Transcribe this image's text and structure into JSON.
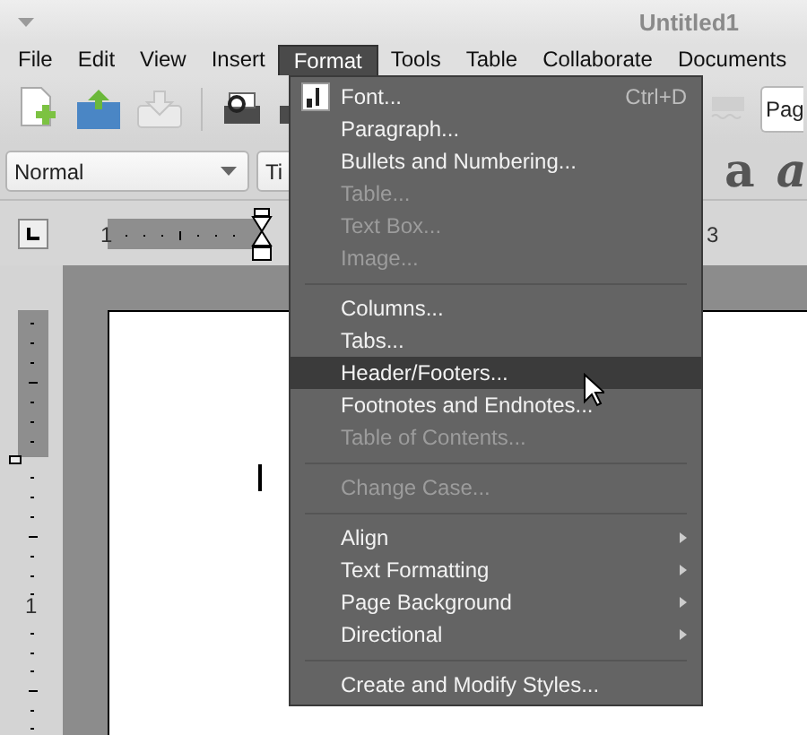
{
  "window": {
    "title": "Untitled1"
  },
  "menu_bar": [
    {
      "label": "File",
      "selected": false
    },
    {
      "label": "Edit",
      "selected": false
    },
    {
      "label": "View",
      "selected": false
    },
    {
      "label": "Insert",
      "selected": false
    },
    {
      "label": "Format",
      "selected": true
    },
    {
      "label": "Tools",
      "selected": false
    },
    {
      "label": "Table",
      "selected": false
    },
    {
      "label": "Collaborate",
      "selected": false
    },
    {
      "label": "Documents",
      "selected": false
    }
  ],
  "toolbar": {
    "page_dropdown": "Pag"
  },
  "format_bar": {
    "style": "Normal",
    "font": "Ti",
    "style_glyphs": [
      "a",
      "a"
    ]
  },
  "horizontal_ruler": {
    "labels": [
      "1",
      "3"
    ]
  },
  "vertical_ruler": {
    "labels": [
      "1"
    ]
  },
  "format_menu": [
    {
      "kind": "item",
      "label": "Font...",
      "shortcut": "Ctrl+D",
      "icon": true,
      "disabled": false,
      "selected": false
    },
    {
      "kind": "item",
      "label": "Paragraph...",
      "disabled": false,
      "selected": false
    },
    {
      "kind": "item",
      "label": "Bullets and Numbering...",
      "disabled": false,
      "selected": false
    },
    {
      "kind": "item",
      "label": "Table...",
      "disabled": true,
      "selected": false
    },
    {
      "kind": "item",
      "label": "Text Box...",
      "disabled": true,
      "selected": false
    },
    {
      "kind": "item",
      "label": "Image...",
      "disabled": true,
      "selected": false
    },
    {
      "kind": "separator"
    },
    {
      "kind": "item",
      "label": "Columns...",
      "disabled": false,
      "selected": false
    },
    {
      "kind": "item",
      "label": "Tabs...",
      "disabled": false,
      "selected": false
    },
    {
      "kind": "item",
      "label": "Header/Footers...",
      "disabled": false,
      "selected": true
    },
    {
      "kind": "item",
      "label": "Footnotes and Endnotes...",
      "disabled": false,
      "selected": false
    },
    {
      "kind": "item",
      "label": "Table of Contents...",
      "disabled": true,
      "selected": false
    },
    {
      "kind": "separator"
    },
    {
      "kind": "item",
      "label": "Change Case...",
      "disabled": true,
      "selected": false
    },
    {
      "kind": "separator"
    },
    {
      "kind": "item",
      "label": "Align",
      "submenu": true,
      "disabled": false,
      "selected": false
    },
    {
      "kind": "item",
      "label": "Text Formatting",
      "submenu": true,
      "disabled": false,
      "selected": false
    },
    {
      "kind": "item",
      "label": "Page Background",
      "submenu": true,
      "disabled": false,
      "selected": false
    },
    {
      "kind": "item",
      "label": "Directional",
      "submenu": true,
      "disabled": false,
      "selected": false
    },
    {
      "kind": "separator"
    },
    {
      "kind": "item",
      "label": "Create and Modify Styles...",
      "disabled": false,
      "selected": false
    }
  ]
}
